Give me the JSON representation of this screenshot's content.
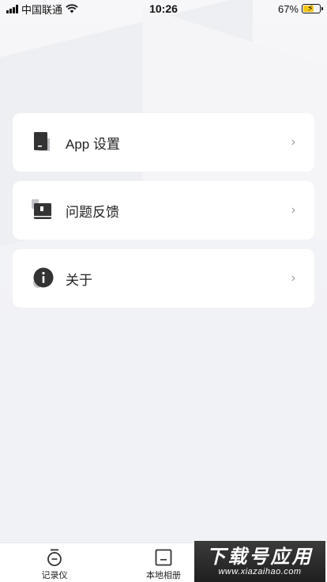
{
  "status_bar": {
    "carrier": "中国联通",
    "time": "10:26",
    "battery": "67%",
    "battery_level": 0.67
  },
  "menu": {
    "items": [
      {
        "label": "App 设置",
        "icon": "app-settings-icon"
      },
      {
        "label": "问题反馈",
        "icon": "feedback-book-icon"
      },
      {
        "label": "关于",
        "icon": "info-icon"
      }
    ],
    "chevron": "›"
  },
  "tabbar": {
    "tabs": [
      {
        "label": "记录仪",
        "icon": "recorder-icon"
      },
      {
        "label": "本地相册",
        "icon": "album-icon"
      }
    ]
  },
  "watermark": {
    "title": "下载号应用",
    "url": "www.xiazaihao.com"
  },
  "colors": {
    "background": "#f1f2f6",
    "card": "#ffffff",
    "icon_dark": "#333333",
    "battery_fill": "#f5c518"
  }
}
